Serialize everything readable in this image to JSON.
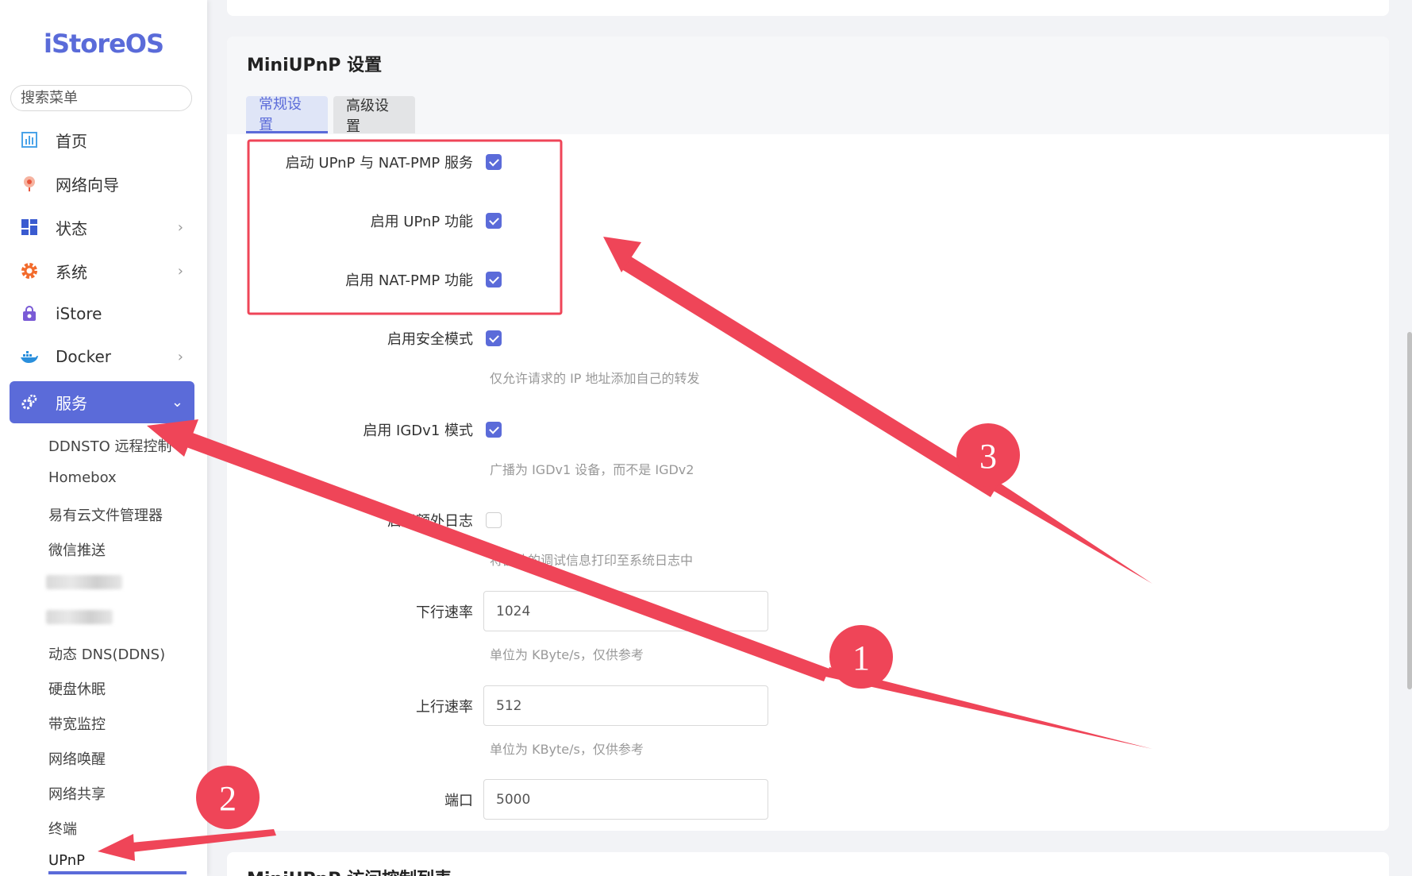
{
  "brand": "iStoreOS",
  "search": {
    "placeholder": "搜索菜单"
  },
  "nav": {
    "home": "首页",
    "wizard": "网络向导",
    "status": "状态",
    "system": "系统",
    "istore": "iStore",
    "docker": "Docker",
    "services": "服务"
  },
  "services_submenu": {
    "ddnsto": "DDNSTO 远程控制",
    "homebox": "Homebox",
    "yiyouyun": "易有云文件管理器",
    "wechat": "微信推送",
    "ddns": "动态 DNS(DDNS)",
    "hd_sleep": "硬盘休眠",
    "bandwidth": "带宽监控",
    "wol": "网络唤醒",
    "share": "网络共享",
    "terminal": "终端",
    "upnp": "UPnP"
  },
  "page": {
    "title": "MiniUPnP 设置",
    "tabs": {
      "general": "常规设置",
      "advanced": "高级设置"
    },
    "fields": {
      "enable_service": {
        "label": "启动 UPnP 与 NAT-PMP 服务",
        "checked": true
      },
      "enable_upnp": {
        "label": "启用 UPnP 功能",
        "checked": true
      },
      "enable_natpmp": {
        "label": "启用 NAT-PMP 功能",
        "checked": true
      },
      "secure_mode": {
        "label": "启用安全模式",
        "checked": true,
        "help": "仅允许请求的 IP 地址添加自己的转发"
      },
      "igdv1": {
        "label": "启用 IGDv1 模式",
        "checked": true,
        "help": "广播为 IGDv1 设备，而不是 IGDv2"
      },
      "extra_log": {
        "label": "启用额外日志",
        "checked": false,
        "help": "将额外的调试信息打印至系统日志中"
      },
      "download": {
        "label": "下行速率",
        "value": "1024",
        "help": "单位为 KByte/s，仅供参考"
      },
      "upload": {
        "label": "上行速率",
        "value": "512",
        "help": "单位为 KByte/s，仅供参考"
      },
      "port": {
        "label": "端口",
        "value": "5000"
      }
    },
    "acl_title": "MiniUPnP 访问控制列表"
  },
  "annotations": {
    "n1": "1",
    "n2": "2",
    "n3": "3"
  },
  "colors": {
    "accent": "#5b6bd9",
    "annotation_red": "#ef4558"
  }
}
